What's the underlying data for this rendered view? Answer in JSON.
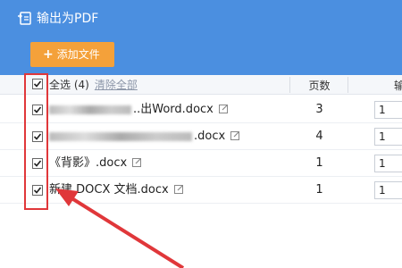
{
  "window": {
    "title": "输出为PDF",
    "icon": "pdf-export-icon"
  },
  "toolbar": {
    "add_label": "添加文件",
    "add_icon": "plus-icon"
  },
  "header": {
    "select_all": "全选 (4)",
    "clear_all": "清除全部",
    "pages_col": "页数",
    "output_col": "输"
  },
  "rows": [
    {
      "name": "..出Word.docx",
      "pages": "3",
      "output": "1",
      "checked": true
    },
    {
      "name": ".docx",
      "pages": "4",
      "output": "1",
      "checked": true
    },
    {
      "name": "《背影》.docx",
      "pages": "1",
      "output": "1",
      "checked": true
    },
    {
      "name": "新建 DOCX 文档.docx",
      "pages": "1",
      "output": "1",
      "checked": true
    }
  ],
  "colors": {
    "titlebar": "#4b8fe0",
    "add_button": "#f4a13a",
    "highlight": "#e0373a"
  }
}
